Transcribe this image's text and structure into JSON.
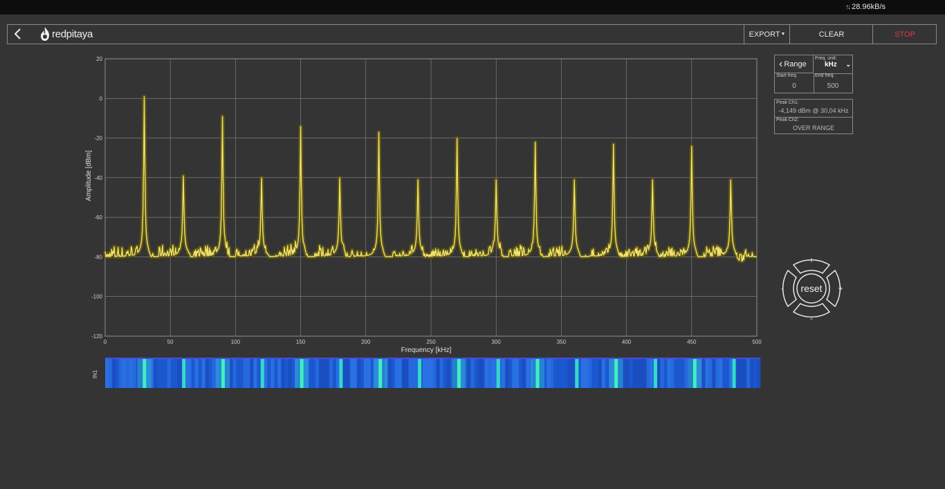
{
  "status": {
    "net_speed": "28.96kB/s",
    "net_icon": "up-down-arrows-icon"
  },
  "nav": {
    "logo_text": "redpitaya",
    "export_label": "EXPORT",
    "clear_label": "CLEAR",
    "stop_label": "STOP",
    "stop_color": "#e0364a"
  },
  "range": {
    "label": "Range",
    "freq_unit_label": "Freq. unit:",
    "freq_unit_value": "kHz",
    "start_label": "Start freq.",
    "start_value": "0",
    "end_label": "End freq.",
    "end_value": "500"
  },
  "peaks": {
    "ch1_label": "Peak Ch1:",
    "ch1_value": "-4,149 dBm @ 30,04 kHz",
    "ch2_label": "Peak Ch2:",
    "ch2_value": "OVER RANGE"
  },
  "pad": {
    "reset_label": "reset",
    "plus": "+",
    "minus": "-"
  },
  "waterfall": {
    "channel_label": "IN1"
  },
  "colors": {
    "trace": "#f3e26a",
    "trace_glow": "#5b5518",
    "background": "#343434",
    "grid": "#8c8c8c"
  },
  "chart_data": {
    "type": "line",
    "xlabel": "Frequency [kHz]",
    "ylabel": "Amplitude [dBm]",
    "xlim": [
      0,
      500
    ],
    "ylim": [
      -120,
      20
    ],
    "x_ticks": [
      0,
      50,
      100,
      150,
      200,
      250,
      300,
      350,
      400,
      450,
      500
    ],
    "y_ticks": [
      20,
      0,
      -20,
      -40,
      -60,
      -80,
      -100,
      -120
    ],
    "grid": true,
    "noise_floor_dbm": -80,
    "peaks": [
      {
        "x": 30,
        "y": -4
      },
      {
        "x": 60,
        "y": -44
      },
      {
        "x": 90,
        "y": -14
      },
      {
        "x": 120,
        "y": -45
      },
      {
        "x": 150,
        "y": -19
      },
      {
        "x": 180,
        "y": -45
      },
      {
        "x": 210,
        "y": -22
      },
      {
        "x": 240,
        "y": -46
      },
      {
        "x": 270,
        "y": -25
      },
      {
        "x": 300,
        "y": -46
      },
      {
        "x": 330,
        "y": -27
      },
      {
        "x": 360,
        "y": -46
      },
      {
        "x": 390,
        "y": -28
      },
      {
        "x": 420,
        "y": -46
      },
      {
        "x": 450,
        "y": -29
      },
      {
        "x": 480,
        "y": -46
      }
    ]
  }
}
